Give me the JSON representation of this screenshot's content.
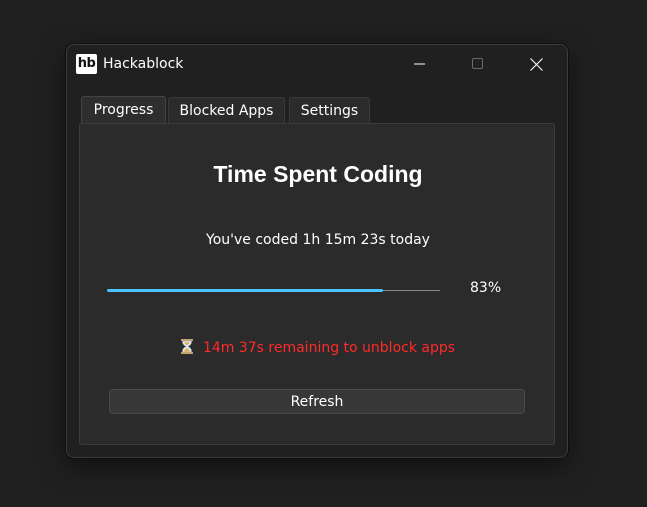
{
  "window": {
    "logo_text": "hb",
    "title": "Hackablock",
    "controls": [
      "minimize-icon",
      "maximize-icon",
      "close-icon"
    ]
  },
  "tabs": [
    {
      "label": "Progress",
      "active": true
    },
    {
      "label": "Blocked Apps",
      "active": false
    },
    {
      "label": "Settings",
      "active": false
    }
  ],
  "progress_tab": {
    "heading": "Time Spent Coding",
    "coded_text": "You've coded 1h 15m 23s today",
    "progress_value": 0.83,
    "progress_label": "83%",
    "remaining_icon": "hourglass-icon",
    "remaining_text": "14m 37s remaining to unblock apps",
    "refresh_label": "Refresh"
  },
  "colors": {
    "background": "#202020",
    "panel": "#2b2b2b",
    "accent": "#4cc2ff",
    "warning": "#ff2b2b",
    "text": "#ffffff"
  }
}
